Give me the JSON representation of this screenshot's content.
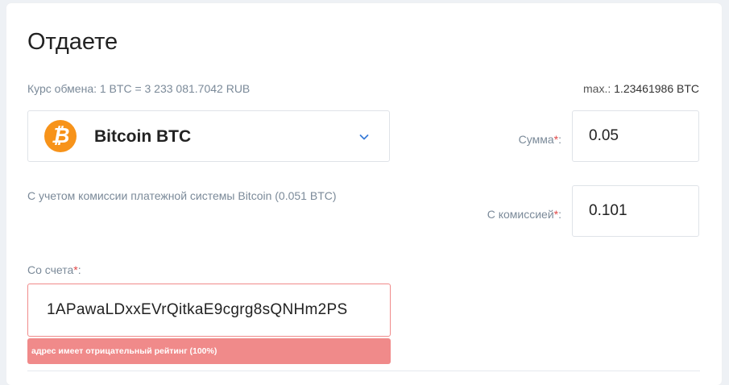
{
  "section": {
    "title": "Отдаете",
    "rate_text": "Курс обмена: 1 BTC = 3 233 081.7042 RUB",
    "max_label": "max.:",
    "max_value": "1.23461986 BTC"
  },
  "currency": {
    "icon": "bitcoin-icon",
    "icon_glyph": "₿",
    "icon_color": "#f7931a",
    "name": "Bitcoin BTC"
  },
  "amount": {
    "label": "Сумма",
    "required_mark": "*",
    "label_suffix": ":",
    "value": "0.05"
  },
  "commission": {
    "label": "С комиссией",
    "required_mark": "*",
    "label_suffix": ":",
    "value": "0.101",
    "note": "С учетом комиссии платежной системы Bitcoin (0.051 BTC)"
  },
  "account": {
    "label": "Со счета",
    "required_mark": "*",
    "label_suffix": ":",
    "value": "1APawaLDxxEVrQitkaE9cgrg8sQNHm2PS",
    "error": "адрес имеет отрицательный рейтинг (100%)",
    "error_color": "#f08a8a"
  },
  "colors": {
    "accent": "#3b7dd8",
    "required": "#e04848"
  }
}
